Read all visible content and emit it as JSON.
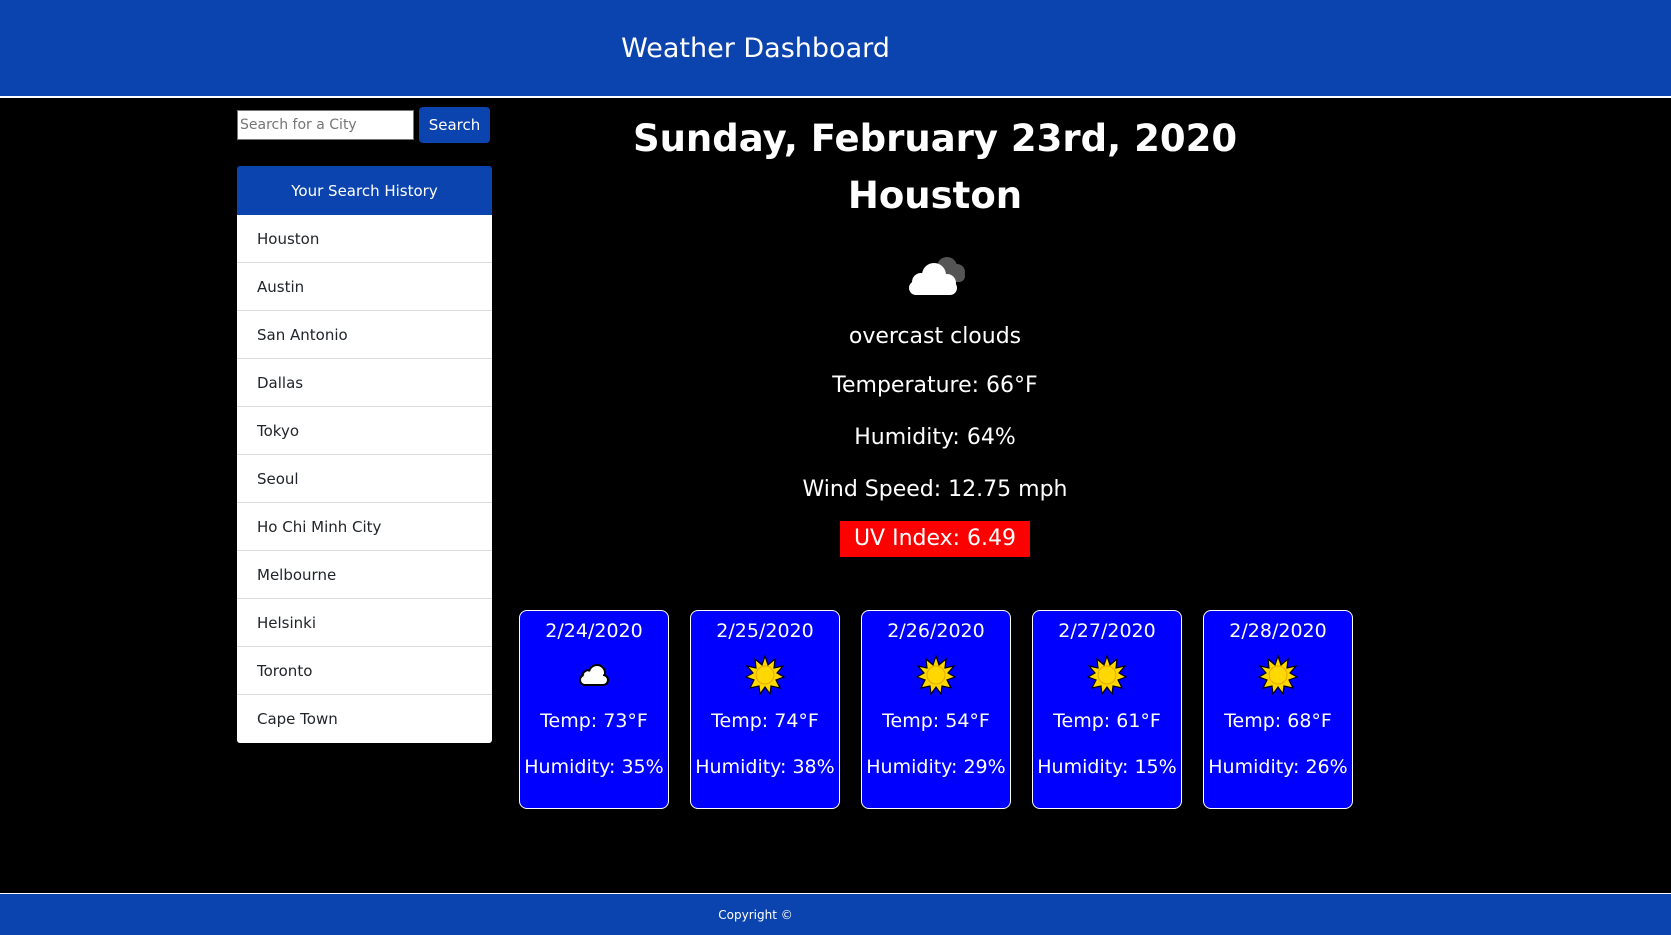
{
  "header": {
    "title": "Weather Dashboard"
  },
  "search": {
    "placeholder": "Search for a City",
    "value": "",
    "button_label": "Search"
  },
  "history": {
    "title": "Your Search History",
    "items": [
      {
        "label": "Houston"
      },
      {
        "label": "Austin"
      },
      {
        "label": "San Antonio"
      },
      {
        "label": "Dallas"
      },
      {
        "label": "Tokyo"
      },
      {
        "label": "Seoul"
      },
      {
        "label": "Ho Chi Minh City"
      },
      {
        "label": "Melbourne"
      },
      {
        "label": "Helsinki"
      },
      {
        "label": "Toronto"
      },
      {
        "label": "Cape Town"
      }
    ]
  },
  "current": {
    "date": "Sunday, February 23rd, 2020",
    "city": "Houston",
    "icon": "overcast-clouds-icon",
    "description": "overcast clouds",
    "temperature": "Temperature: 66°F",
    "humidity": "Humidity: 64%",
    "wind": "Wind Speed: 12.75 mph",
    "uv": "UV Index: 6.49"
  },
  "forecast": [
    {
      "date": "2/24/2020",
      "icon": "cloud-icon",
      "temp": "Temp: 73°F",
      "humidity": "Humidity: 35%"
    },
    {
      "date": "2/25/2020",
      "icon": "sun-icon",
      "temp": "Temp: 74°F",
      "humidity": "Humidity: 38%"
    },
    {
      "date": "2/26/2020",
      "icon": "sun-icon",
      "temp": "Temp: 54°F",
      "humidity": "Humidity: 29%"
    },
    {
      "date": "2/27/2020",
      "icon": "sun-icon",
      "temp": "Temp: 61°F",
      "humidity": "Humidity: 15%"
    },
    {
      "date": "2/28/2020",
      "icon": "sun-icon",
      "temp": "Temp: 68°F",
      "humidity": "Humidity: 26%"
    }
  ],
  "footer": {
    "text": "Copyright ©"
  },
  "colors": {
    "brand": "#0b44ae",
    "card": "#0000ff",
    "uv": "#ff0000",
    "background": "#000000"
  }
}
